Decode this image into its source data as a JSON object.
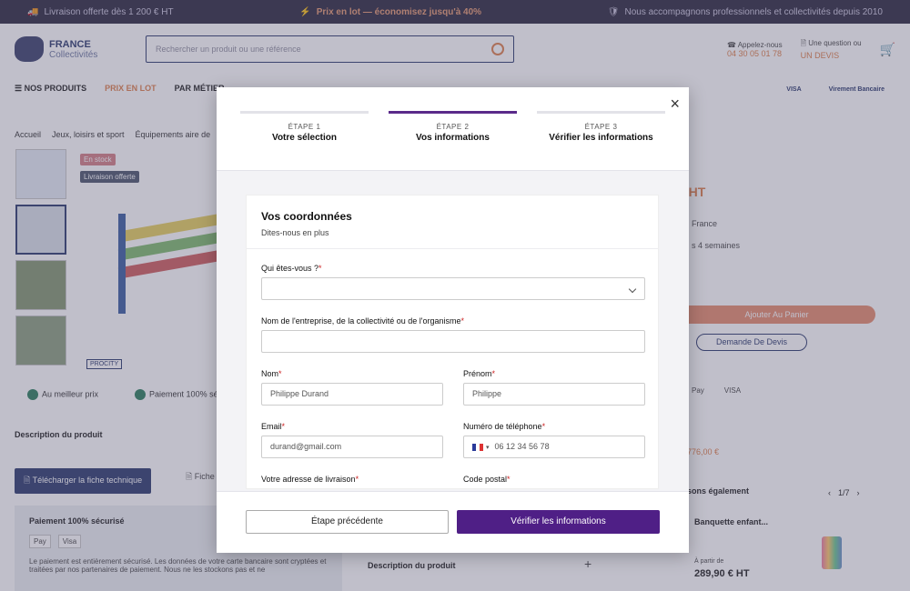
{
  "topbar": {
    "left": "Livraison offerte dès 1 200 € HT",
    "mid": "Prix en lot — économisez jusqu'à 40%",
    "right": "Nous accompagnons professionnels et collectivités depuis 2010"
  },
  "logo": {
    "line1": "FRANCE",
    "line2": "Collectivités"
  },
  "search": {
    "placeholder": "Rechercher un produit ou une référence"
  },
  "contact": {
    "phone_label": "Appelez-nous",
    "phone": "04 30 05 01 78",
    "question_label": "Une question ou",
    "question_link": "UN DEVIS"
  },
  "nav": {
    "products": "NOS PRODUITS",
    "lot": "PRIX EN LOT",
    "job": "PAR MÉTIER"
  },
  "paylogos": [
    "VISA",
    "Virement Bancaire"
  ],
  "breadcrumb": [
    "Accueil",
    "Jeux, loisirs et sport",
    "Équipements aire de"
  ],
  "badges": {
    "b1": "En stock",
    "b2": "Livraison offerte"
  },
  "brand_tag": "PROCITY",
  "assurances": [
    "Au meilleur prix",
    "Paiement 100% sé"
  ],
  "page": {
    "desc": "Description du produit",
    "download": "Télécharger la fiche technique",
    "fiche": "Fiche"
  },
  "secure": {
    "title": "Paiement 100% sécurisé",
    "methods": [
      "Pay",
      "Visa"
    ],
    "text": "Le paiement est entièrement sécurisé. Les données de votre carte bancaire sont cryptées et traitées par nos partenaires de paiement. Nous ne les stockons pas et ne"
  },
  "right": {
    "price": "€ HT",
    "l1": "France",
    "l2": "s 4 semaines",
    "cart": "Ajouter Au Panier",
    "devis": "Demande De Devis",
    "pay": [
      "Pay",
      "VISA"
    ],
    "old": "776,00 €",
    "similar": "sons également",
    "pager": "1/7",
    "card_title": "Banquette enfant...",
    "card_from": "À partir de",
    "card_price": "289,90 € HT"
  },
  "modal": {
    "close": "×",
    "steps": [
      {
        "num": "ÉTAPE 1",
        "label": "Votre sélection"
      },
      {
        "num": "ÉTAPE 2",
        "label": "Vos informations"
      },
      {
        "num": "ÉTAPE 3",
        "label": "Vérifier les informations"
      }
    ],
    "title": "Vos coordonnées",
    "subtitle": "Dites-nous en plus",
    "fields": {
      "who": "Qui êtes-vous ?",
      "company": "Nom de l'entreprise, de la collectivité ou de l'organisme",
      "nom": "Nom",
      "nom_value": "Philippe Durand",
      "prenom": "Prénom",
      "prenom_value": "Philippe",
      "email": "Email",
      "email_value": "durand@gmail.com",
      "tel": "Numéro de téléphone",
      "tel_value": "06 12 34 56 78",
      "address": "Votre adresse de livraison",
      "postal": "Code postal",
      "req": "*"
    },
    "prev": "Étape précédente",
    "next": "Vérifier les informations"
  }
}
